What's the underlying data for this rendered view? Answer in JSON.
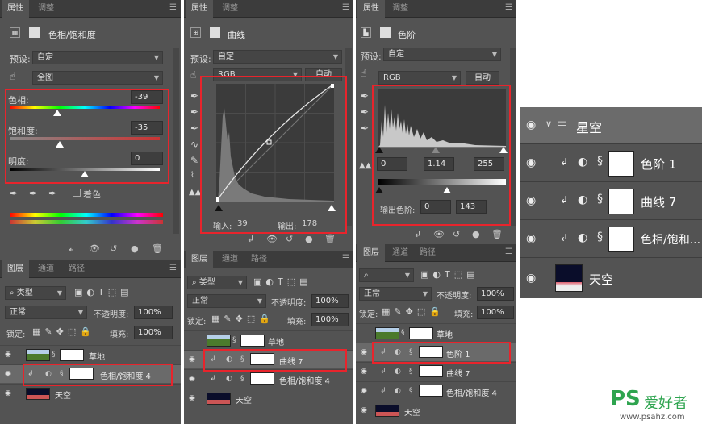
{
  "panel1": {
    "tabs": [
      "属性",
      "调整"
    ],
    "title": "色相/饱和度",
    "preset_label": "预设:",
    "preset_value": "自定",
    "range_value": "全图",
    "hue_label": "色相:",
    "hue_value": "-39",
    "sat_label": "饱和度:",
    "sat_value": "-35",
    "light_label": "明度:",
    "light_value": "0",
    "colorize_label": "着色",
    "layers_tabs": [
      "图层",
      "通道",
      "路径"
    ],
    "filter_label": "类型",
    "blend_mode": "正常",
    "opacity_label": "不透明度:",
    "opacity_value": "100%",
    "lock_label": "锁定:",
    "fill_label": "填充:",
    "fill_value": "100%",
    "layers": [
      {
        "name": "草地"
      },
      {
        "name": "色相/饱和度 4"
      },
      {
        "name": "天空"
      }
    ]
  },
  "panel2": {
    "tabs": [
      "属性",
      "调整"
    ],
    "title": "曲线",
    "preset_label": "预设:",
    "preset_value": "自定",
    "channel": "RGB",
    "auto_label": "自动",
    "input_label": "输入:",
    "input_value": "39",
    "output_label": "输出:",
    "output_value": "178",
    "layers_tabs": [
      "图层",
      "通道",
      "路径"
    ],
    "filter_label": "类型",
    "blend_mode": "正常",
    "opacity_label": "不透明度:",
    "opacity_value": "100%",
    "lock_label": "锁定:",
    "fill_label": "填充:",
    "fill_value": "100%",
    "layers": [
      {
        "name": "草地"
      },
      {
        "name": "曲线 7"
      },
      {
        "name": "色相/饱和度 4"
      },
      {
        "name": "天空"
      }
    ]
  },
  "panel3": {
    "tabs": [
      "属性",
      "调整"
    ],
    "title": "色阶",
    "preset_label": "预设:",
    "preset_value": "自定",
    "channel": "RGB",
    "auto_label": "自动",
    "in_black": "0",
    "in_gamma": "1.14",
    "in_white": "255",
    "output_label": "输出色阶:",
    "out_black": "0",
    "out_white": "143",
    "layers_tabs": [
      "图层",
      "通道",
      "路径"
    ],
    "blend_mode": "正常",
    "opacity_label": "不透明度:",
    "opacity_value": "100%",
    "lock_label": "锁定:",
    "fill_label": "填充:",
    "fill_value": "100%",
    "layers": [
      {
        "name": "草地"
      },
      {
        "name": "色阶 1"
      },
      {
        "name": "曲线 7"
      },
      {
        "name": "色相/饱和度 4"
      },
      {
        "name": "天空"
      }
    ]
  },
  "zoom": {
    "group": "星空",
    "layers": [
      {
        "name": "色阶 1"
      },
      {
        "name": "曲线 7"
      },
      {
        "name": "色相/饱和..."
      },
      {
        "name": "天空"
      }
    ]
  },
  "watermark": {
    "brand": "PS",
    "cn": "爱好者",
    "url": "www.psahz.com"
  },
  "colors": {
    "highlight": "#e8242c",
    "panel": "#535353",
    "accent": "#2ea44f"
  }
}
